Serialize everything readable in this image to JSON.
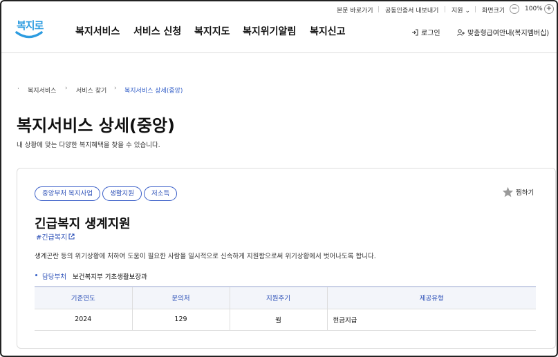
{
  "utility": {
    "skip_link": "본문 바로가기",
    "cert_export": "공동인증서 내보내기",
    "support": "지원",
    "zoom_label": "화면크기",
    "zoom_minus": "−",
    "zoom_value": "100%",
    "zoom_plus": "+"
  },
  "logo": {
    "text": "복지로"
  },
  "nav": {
    "items": [
      "복지서비스",
      "서비스 신청",
      "복지지도",
      "복지위기알림",
      "복지신고"
    ]
  },
  "header": {
    "login": "로그인",
    "guide": "맞춤형급여안내(복지멤버십)"
  },
  "breadcrumb": {
    "items": [
      "복지서비스",
      "서비스 찾기",
      "복지서비스 상세(중앙)"
    ]
  },
  "page": {
    "title": "복지서비스 상세(중앙)",
    "description": "내 상황에 맞는 다양한 복지혜택을 찾을 수 있습니다."
  },
  "service": {
    "tags": [
      "중앙부처 복지사업",
      "생활지원",
      "저소득"
    ],
    "favorite_label": "찜하기",
    "title": "긴급복지 생계지원",
    "hashtag": "#긴급복지",
    "description": "생계곤란 등의 위기상황에 처하여 도움이 필요한 사람을 일시적으로 신속하게 지원함으로써 위기상황에서 벗어나도록 합니다.",
    "dept_label": "담당부처",
    "dept_value": "보건복지부 기초생활보장과"
  },
  "table": {
    "headers": [
      "기준연도",
      "문의처",
      "지원주기",
      "제공유형"
    ],
    "rows": [
      [
        "2024",
        "129",
        "월",
        "현금지급"
      ]
    ]
  },
  "colors": {
    "accent": "#2b4fb7",
    "logo": "#2d9ce0",
    "table_header_bg": "#f3f5fa"
  }
}
